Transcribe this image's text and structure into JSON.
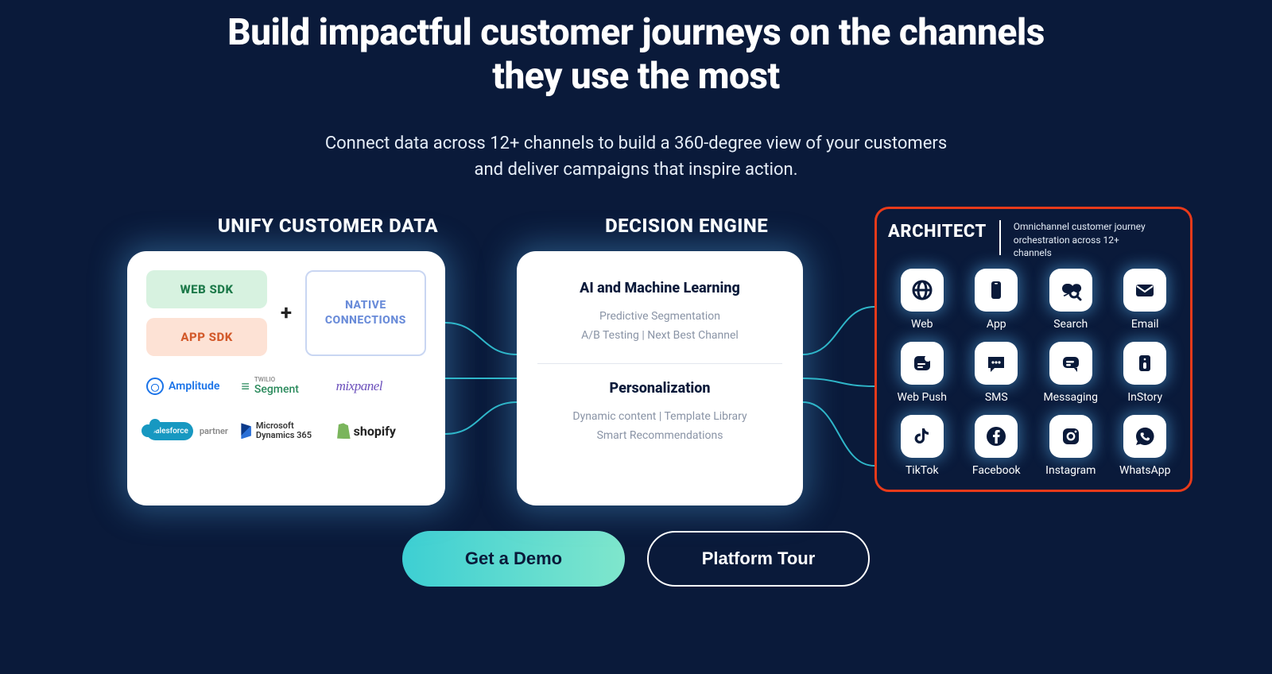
{
  "hero": {
    "title": "Build impactful customer journeys on the channels they use the most",
    "subtitle": "Connect data across 12+ channels to build a 360-degree view of your customers and deliver campaigns that inspire action."
  },
  "sections": {
    "unify": "UNIFY CUSTOMER DATA",
    "engine": "DECISION ENGINE",
    "architect": "ARCHITECT",
    "architect_sub": "Omnichannel customer journey orchestration across 12+ channels"
  },
  "unify_card": {
    "web_sdk": "WEB SDK",
    "app_sdk": "APP SDK",
    "plus": "+",
    "native": "NATIVE CONNECTIONS",
    "logos": {
      "amplitude": "Amplitude",
      "segment_small": "TWILIO",
      "segment": "Segment",
      "mixpanel": "mixpanel",
      "salesforce": "salesforce",
      "salesforce_partner": "partner",
      "dynamics": "Microsoft Dynamics 365",
      "shopify": "shopify"
    }
  },
  "engine_card": {
    "h1": "AI and Machine Learning",
    "p1": "Predictive Segmentation",
    "p2": "A/B Testing | Next Best Channel",
    "h2": "Personalization",
    "p3": "Dynamic content | Template Library",
    "p4": "Smart Recommendations"
  },
  "channels": [
    {
      "label": "Web",
      "icon": "globe-icon"
    },
    {
      "label": "App",
      "icon": "phone-icon"
    },
    {
      "label": "Search",
      "icon": "search-icon"
    },
    {
      "label": "Email",
      "icon": "mail-icon"
    },
    {
      "label": "Web Push",
      "icon": "push-icon"
    },
    {
      "label": "SMS",
      "icon": "sms-icon"
    },
    {
      "label": "Messaging",
      "icon": "messaging-icon"
    },
    {
      "label": "InStory",
      "icon": "instory-icon"
    },
    {
      "label": "TikTok",
      "icon": "tiktok-icon"
    },
    {
      "label": "Facebook",
      "icon": "facebook-icon"
    },
    {
      "label": "Instagram",
      "icon": "instagram-icon"
    },
    {
      "label": "WhatsApp",
      "icon": "whatsapp-icon"
    }
  ],
  "cta": {
    "demo": "Get a Demo",
    "tour": "Platform Tour"
  }
}
